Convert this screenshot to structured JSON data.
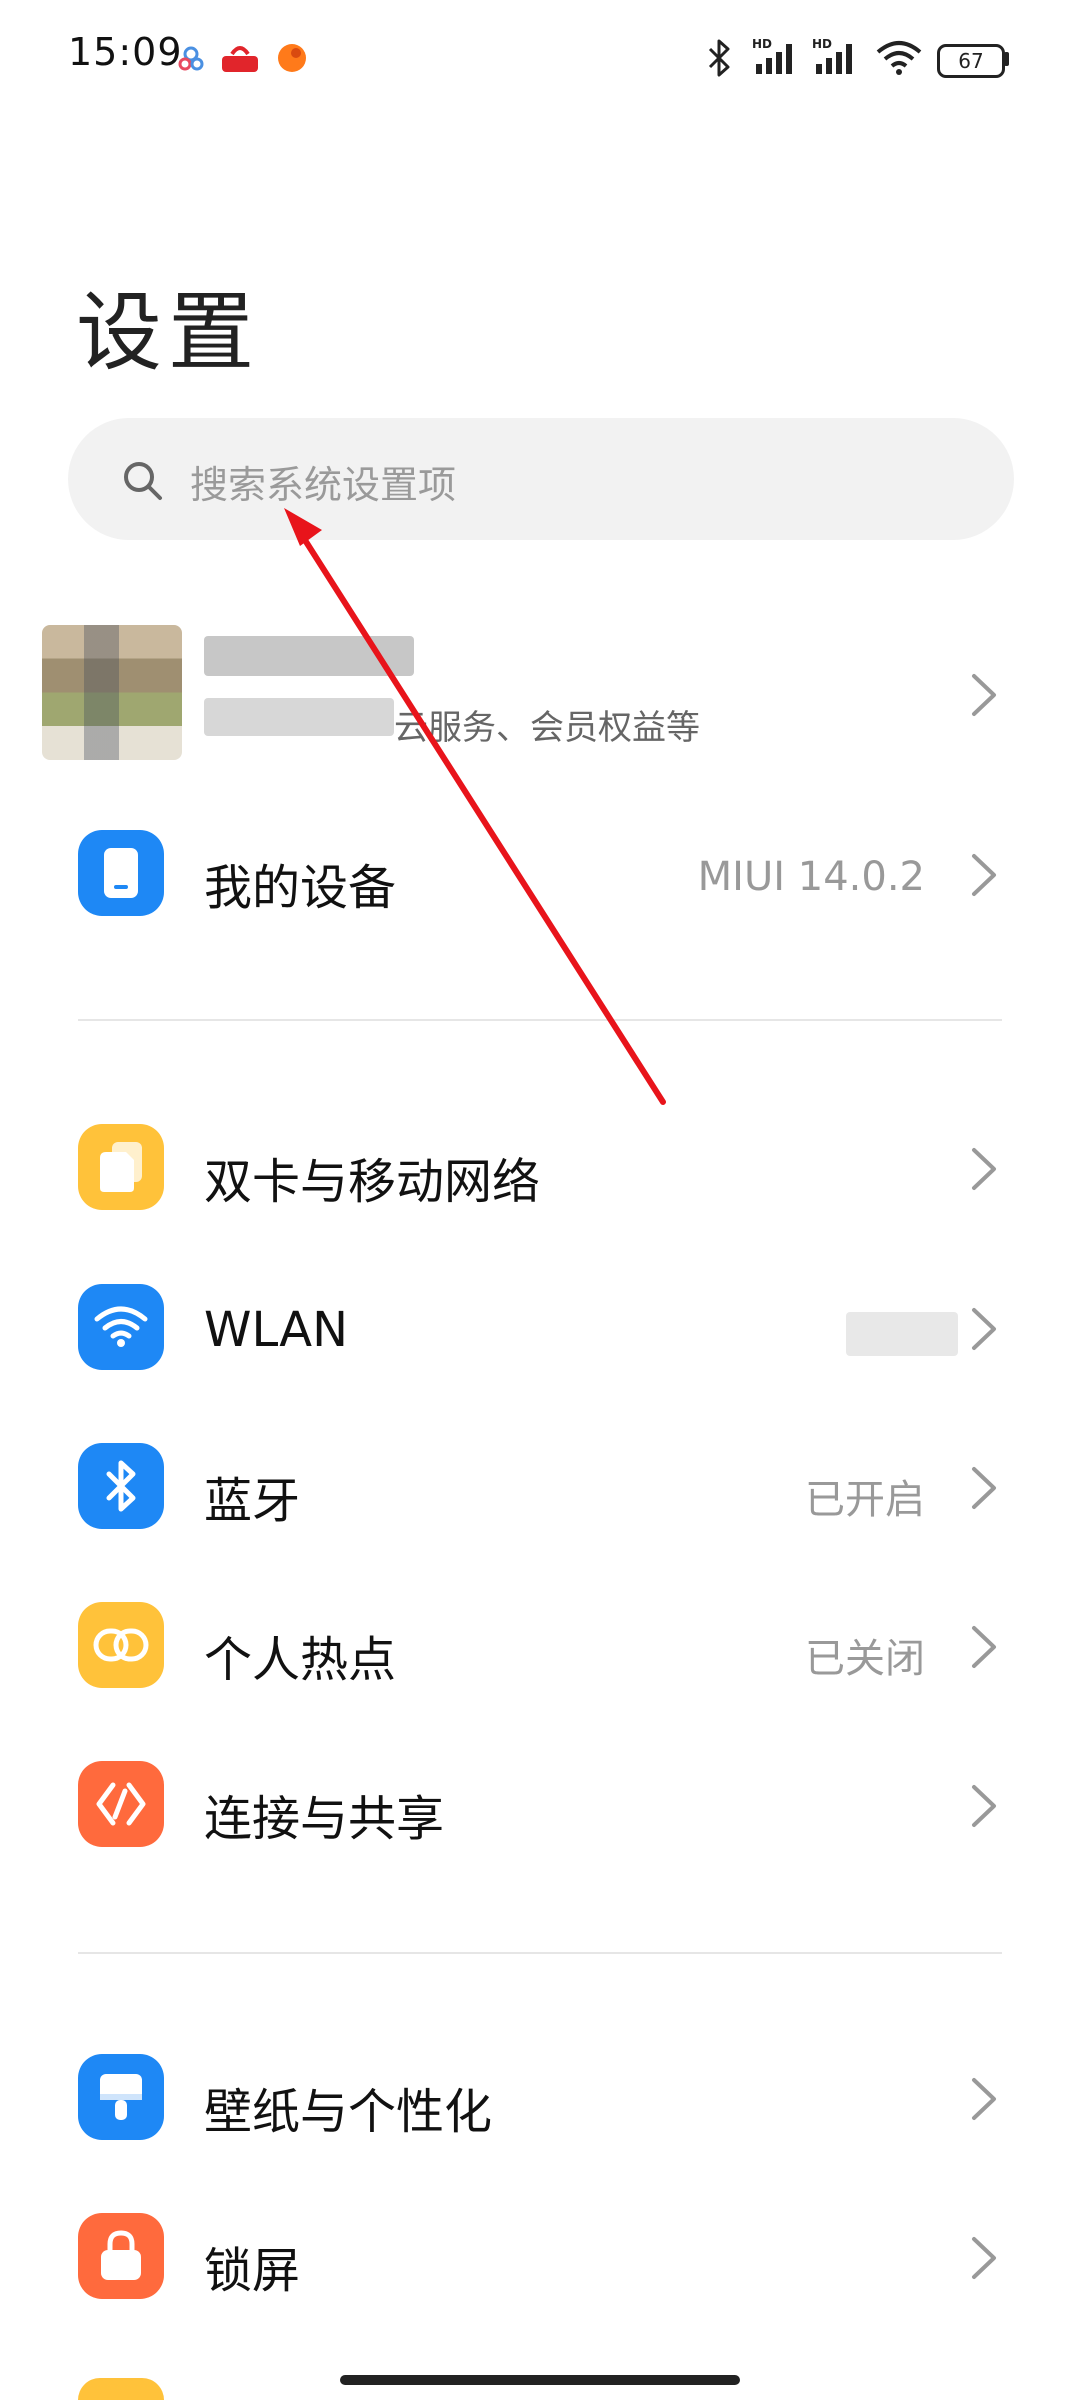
{
  "status_bar": {
    "time": "15:09",
    "battery": "67",
    "icons": [
      "notification-app-icon",
      "notification-app-icon",
      "notification-app-icon",
      "bluetooth-icon",
      "signal-hd-icon",
      "signal-hd-icon",
      "wifi-icon",
      "battery-icon"
    ]
  },
  "page": {
    "title": "设置"
  },
  "search": {
    "placeholder": "搜索系统设置项"
  },
  "account": {
    "subtitle": "云服务、会员权益等"
  },
  "sections": [
    {
      "items": [
        {
          "label": "我的设备",
          "value": "MIUI 14.0.2",
          "icon": "phone-icon",
          "color": "#1e88f5"
        }
      ]
    },
    {
      "items": [
        {
          "label": "双卡与移动网络",
          "value": "",
          "icon": "sim-icon",
          "color": "#ffc23a"
        },
        {
          "label": "WLAN",
          "value": "",
          "icon": "wifi-icon",
          "color": "#1e88f5"
        },
        {
          "label": "蓝牙",
          "value": "已开启",
          "icon": "bluetooth-icon",
          "color": "#1e88f5"
        },
        {
          "label": "个人热点",
          "value": "已关闭",
          "icon": "hotspot-icon",
          "color": "#ffc23a"
        },
        {
          "label": "连接与共享",
          "value": "",
          "icon": "connection-share-icon",
          "color": "#ff6a3d"
        }
      ]
    },
    {
      "items": [
        {
          "label": "壁纸与个性化",
          "value": "",
          "icon": "wallpaper-icon",
          "color": "#1e88f5"
        },
        {
          "label": "锁屏",
          "value": "",
          "icon": "lock-icon",
          "color": "#ff6a3d"
        }
      ]
    }
  ],
  "annotation": {
    "color": "#e8141b"
  }
}
